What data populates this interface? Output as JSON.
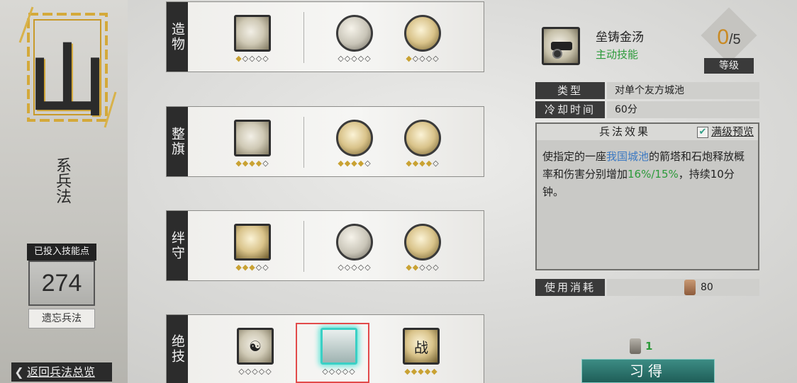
{
  "school": {
    "char": "山",
    "subtitle": "系兵法",
    "points_label": "已投入技能点",
    "points_value": "274",
    "forget_label": "遗忘兵法",
    "back_label": "返回兵法总览"
  },
  "rows": [
    {
      "label": "造物",
      "skills": [
        {
          "name": "craft-skill-1",
          "stars": "◆◇◇◇◇"
        },
        {
          "name": "craft-skill-2",
          "stars": "◇◇◇◇◇"
        },
        {
          "name": "craft-skill-3",
          "stars": "◆◇◇◇◇"
        }
      ]
    },
    {
      "label": "整旗",
      "skills": [
        {
          "name": "banner-skill-1",
          "stars": "◆◆◆◆◇"
        },
        {
          "name": "banner-skill-2",
          "stars": "◆◆◆◆◇"
        },
        {
          "name": "banner-skill-3",
          "stars": "◆◆◆◆◇"
        }
      ]
    },
    {
      "label": "绊守",
      "skills": [
        {
          "name": "guard-skill-1",
          "stars": "◆◆◆◇◇"
        },
        {
          "name": "guard-skill-2",
          "stars": "◇◇◇◇◇"
        },
        {
          "name": "guard-skill-3",
          "stars": "◆◆◇◇◇"
        }
      ]
    },
    {
      "label": "绝技",
      "skills": [
        {
          "name": "ultimate-skill-1",
          "stars": "◇◇◇◇◇"
        },
        {
          "name": "ultimate-skill-2",
          "stars": "◇◇◇◇◇"
        },
        {
          "name": "ultimate-skill-3",
          "stars": "◆◆◆◆◆",
          "glyph": "战"
        }
      ]
    }
  ],
  "detail": {
    "name": "垒铸金汤",
    "kind": "主动技能",
    "level_current": "0",
    "level_max": "/5",
    "level_label": "等级",
    "type_key": "类型",
    "type_value": "对单个友方城池",
    "cooldown_key": "冷却时间",
    "cooldown_value": "60分",
    "effect_title": "兵法效果",
    "preview_label": "满级预览",
    "preview_checked": true,
    "effect_text_1": "使指定的一座",
    "effect_highlight_1": "我国城池",
    "effect_text_2": "的箭塔和石炮释放概率和伤害分别增加",
    "effect_highlight_2": "16%/15%",
    "effect_text_3": "，持续10分钟。",
    "cost_key": "使用消耗",
    "cost_value": "80",
    "learn_cost": "1",
    "learn_label": "习得"
  },
  "colors": {
    "accent_teal": "#3ad0c5",
    "highlight_blue": "#3a78c2",
    "highlight_green": "#2c9a3a",
    "level_orange": "#c98a24",
    "selection_red": "#e24a4a"
  }
}
